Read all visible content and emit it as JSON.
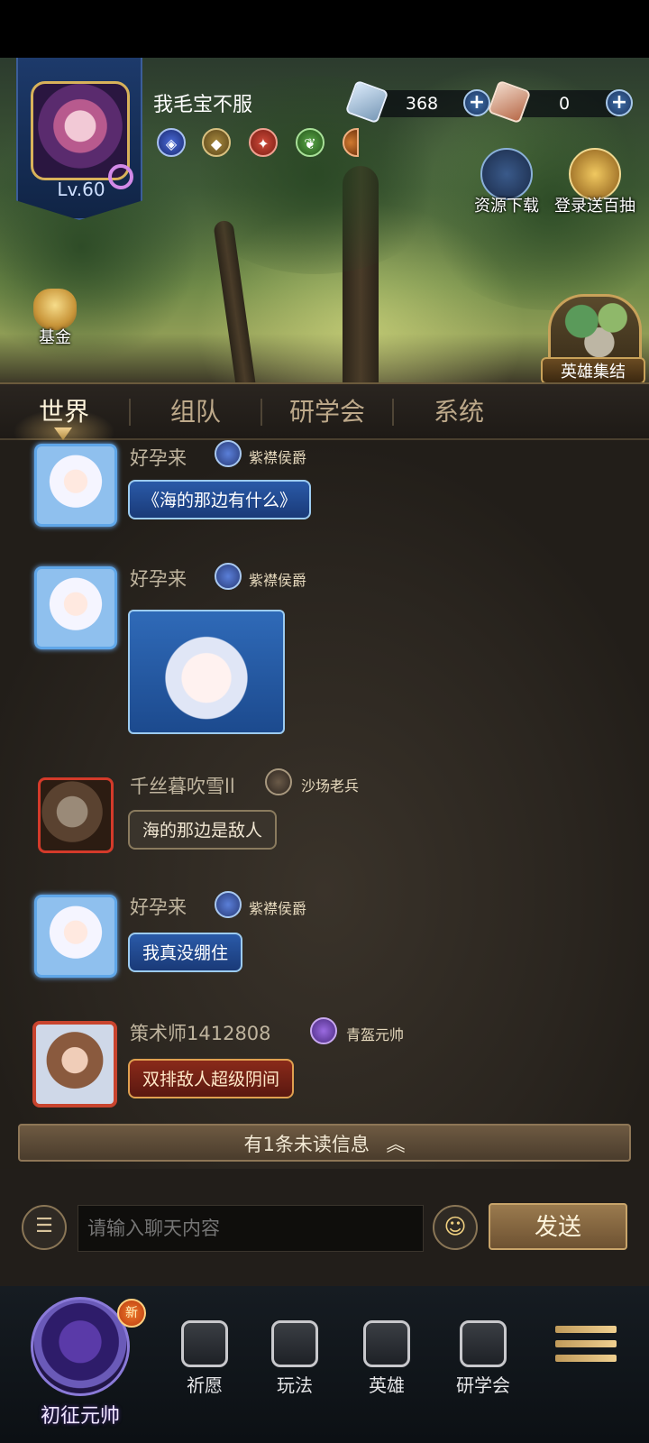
{
  "player": {
    "name": "我毛宝不服",
    "level": "Lv.60"
  },
  "currencies": [
    {
      "icon": "blue-crystal-icon",
      "value": "368"
    },
    {
      "icon": "red-scroll-icon",
      "value": "0"
    }
  ],
  "top_actions": {
    "download": "资源下载",
    "login_gift": "登录送百抽",
    "fund": "基金",
    "heroes_gather": "英雄集结"
  },
  "tabs": [
    "世界",
    "组队",
    "研学会",
    "系统"
  ],
  "active_tab": "世界",
  "messages": [
    {
      "name": "好孕来",
      "rank": "紫襟侯爵",
      "text": "《海的那边有什么》"
    },
    {
      "name": "好孕来",
      "rank": "紫襟侯爵",
      "sticker": "mermaid-sticker"
    },
    {
      "name": "千丝暮吹雪ll",
      "rank": "沙场老兵",
      "text": "海的那边是敌人"
    },
    {
      "name": "好孕来",
      "rank": "紫襟侯爵",
      "text": "我真没绷住"
    },
    {
      "name": "策术师1412808",
      "rank": "青盔元帅",
      "text": "双排敌人超级阴间"
    }
  ],
  "unread_bar": "有1条未读信息",
  "input": {
    "placeholder": "请输入聊天内容",
    "send_label": "发送"
  },
  "bottom_nav": {
    "rank_title": "初征元帅",
    "new_badge": "新",
    "items": [
      "祈愿",
      "玩法",
      "英雄",
      "研学会"
    ]
  },
  "colors": {
    "accent_gold": "#c8a46a",
    "tab_active": "#fff5dc",
    "bubble_blue": "#2a5aa8"
  }
}
